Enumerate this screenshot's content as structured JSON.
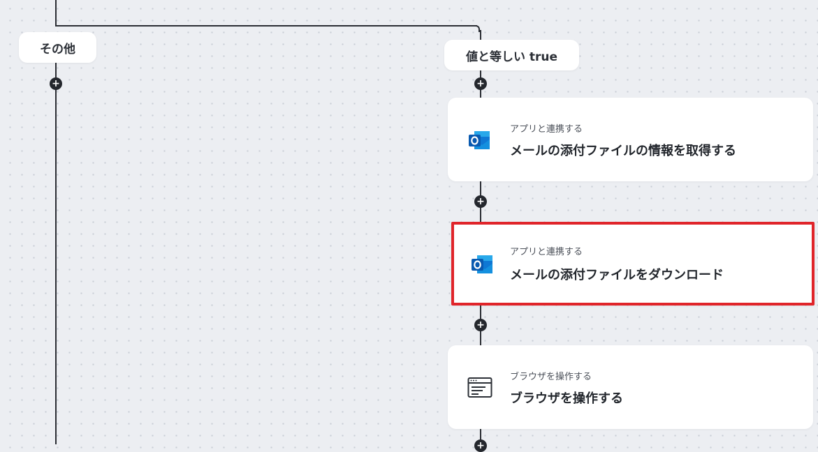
{
  "branches": {
    "left_label": "その他",
    "right_label": "値と等しい true"
  },
  "steps": [
    {
      "category": "アプリと連携する",
      "title": "メールの添付ファイルの情報を取得する",
      "icon": "outlook-icon"
    },
    {
      "category": "アプリと連携する",
      "title": "メールの添付ファイルをダウンロード",
      "icon": "outlook-icon",
      "highlighted": true
    },
    {
      "category": "ブラウザを操作する",
      "title": "ブラウザを操作する",
      "icon": "browser-window-icon"
    }
  ],
  "add_node_symbol": "+",
  "colors": {
    "background": "#eceef2",
    "wire": "#2a2d33",
    "highlight_border": "#e0242a",
    "outlook_blue": "#0a64c8"
  }
}
